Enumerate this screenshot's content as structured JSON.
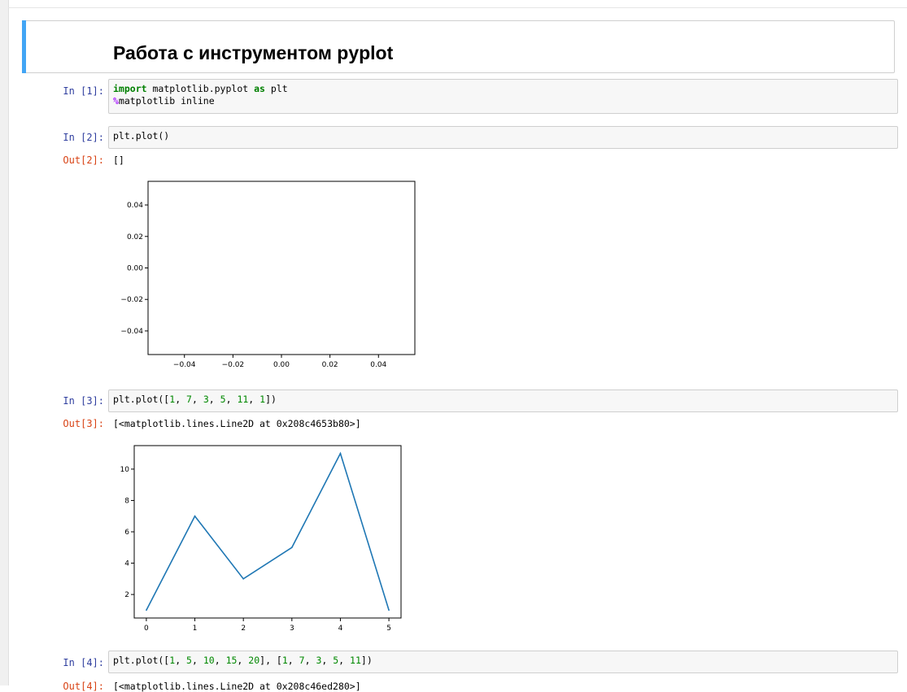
{
  "markdown": {
    "title": "Работа с инструментом pyplot"
  },
  "cells": [
    {
      "prompt": "In [1]:",
      "line1": {
        "kw1": "import",
        "mid": " matplotlib.pyplot ",
        "kw2": "as",
        "end": " plt"
      },
      "line2": {
        "magic": "%",
        "rest": "matplotlib inline"
      }
    },
    {
      "prompt": "In [2]:",
      "code": "plt.plot()",
      "out_prompt": "Out[2]:",
      "out_text": "[]"
    },
    {
      "prompt": "In [3]:",
      "code": {
        "pre": "plt.plot([",
        "nums": [
          "1",
          "7",
          "3",
          "5",
          "11",
          "1"
        ],
        "post": "])"
      },
      "out_prompt": "Out[3]:",
      "out_text": "[<matplotlib.lines.Line2D at 0x208c4653b80>]"
    },
    {
      "prompt": "In [4]:",
      "code": {
        "pre": "plt.plot([",
        "nums_a": [
          "1",
          "5",
          "10",
          "15",
          "20"
        ],
        "mid": "], [",
        "nums_b": [
          "1",
          "7",
          "3",
          "5",
          "11"
        ],
        "post": "])"
      },
      "out_prompt": "Out[4]:",
      "out_text": "[<matplotlib.lines.Line2D at 0x208c46ed280>]"
    }
  ],
  "chart_data": [
    {
      "type": "line",
      "x": [],
      "y": [],
      "xlim": [
        -0.055,
        0.055
      ],
      "ylim": [
        -0.055,
        0.055
      ],
      "xticks": [
        "−0.04",
        "−0.02",
        "0.00",
        "0.02",
        "0.04"
      ],
      "yticks": [
        "0.04",
        "0.02",
        "0.00",
        "−0.02",
        "−0.04"
      ],
      "grid": false
    },
    {
      "type": "line",
      "x": [
        0,
        1,
        2,
        3,
        4,
        5
      ],
      "y": [
        1,
        7,
        3,
        5,
        11,
        1
      ],
      "xlim": [
        -0.25,
        5.25
      ],
      "ylim": [
        0.5,
        11.5
      ],
      "xticks": [
        "0",
        "1",
        "2",
        "3",
        "4",
        "5"
      ],
      "yticks": [
        "2",
        "4",
        "6",
        "8",
        "10"
      ],
      "line_color": "#1f77b4",
      "grid": false
    }
  ],
  "colors": {
    "in_prompt": "#303f9f",
    "out_prompt": "#d84315",
    "md_accent": "#42a5f5"
  }
}
